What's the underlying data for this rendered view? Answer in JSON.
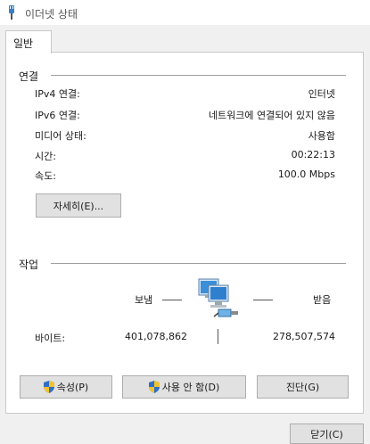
{
  "window": {
    "title": "이더넷 상태"
  },
  "tabs": [
    {
      "label": "일반"
    }
  ],
  "connection": {
    "group_label": "연결",
    "rows": [
      {
        "label": "IPv4 연결:",
        "value": "인터넷"
      },
      {
        "label": "IPv6 연결:",
        "value": "네트워크에 연결되어 있지 않음"
      },
      {
        "label": "미디어 상태:",
        "value": "사용함"
      },
      {
        "label": "시간:",
        "value": "00:22:13"
      },
      {
        "label": "속도:",
        "value": "100.0 Mbps"
      }
    ],
    "details_button": "자세히(E)..."
  },
  "activity": {
    "group_label": "작업",
    "sent_label": "보냄",
    "received_label": "받음",
    "bytes_label": "바이트:",
    "bytes_sent": "401,078,862",
    "bytes_received": "278,507,574"
  },
  "buttons": {
    "properties": "속성(P)",
    "disable": "사용 안 함(D)",
    "diagnose": "진단(G)",
    "close": "닫기(C)"
  },
  "icons": {
    "window": "ethernet-plug-icon",
    "activity": "network-computers-icon",
    "shield": "uac-shield-icon"
  }
}
